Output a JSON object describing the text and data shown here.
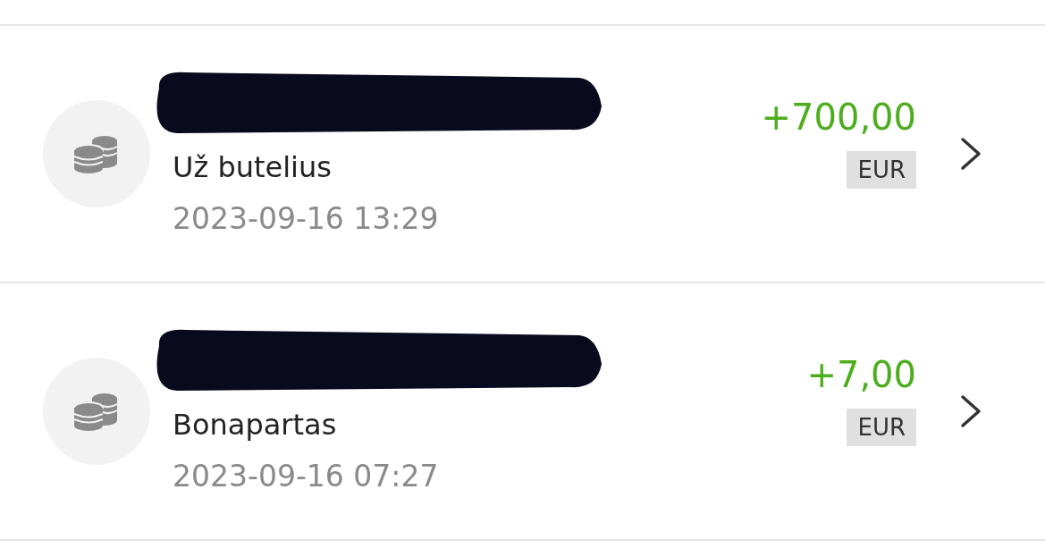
{
  "transactions": [
    {
      "title_redacted": true,
      "subtitle": "Už butelius",
      "datetime": "2023-09-16 13:29",
      "amount": "+700,00",
      "currency": "EUR"
    },
    {
      "title_redacted": true,
      "subtitle": "Bonapartas",
      "datetime": "2023-09-16 07:27",
      "amount": "+7,00",
      "currency": "EUR"
    }
  ]
}
